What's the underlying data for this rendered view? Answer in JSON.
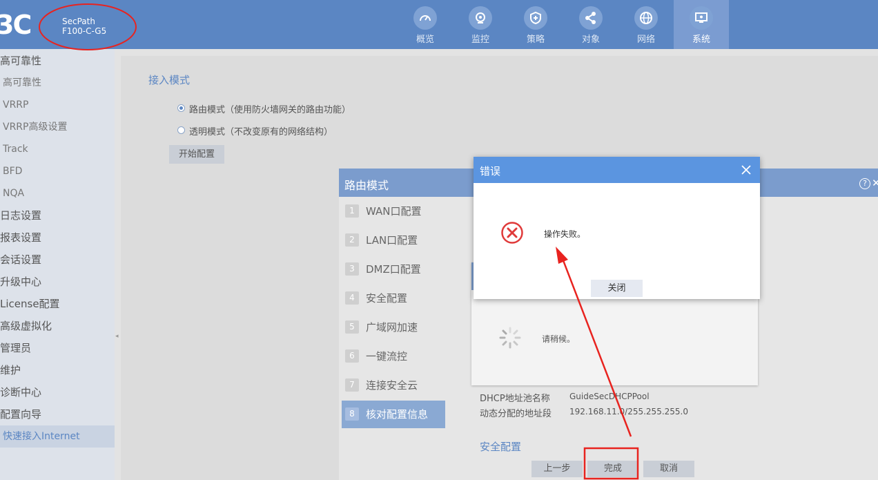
{
  "header": {
    "logo_text": "3C",
    "model_line1": "SecPath",
    "model_line2": "F100-C-G5",
    "nav": [
      {
        "label": "概览",
        "icon": "gauge-icon"
      },
      {
        "label": "监控",
        "icon": "camera-icon"
      },
      {
        "label": "策略",
        "icon": "shield-icon"
      },
      {
        "label": "对象",
        "icon": "share-icon"
      },
      {
        "label": "网络",
        "icon": "globe-icon"
      },
      {
        "label": "系统",
        "icon": "monitor-icon",
        "active": true
      }
    ]
  },
  "sidebar": {
    "items": [
      {
        "label": "高可靠性"
      },
      {
        "label": "高可靠性"
      },
      {
        "label": "VRRP"
      },
      {
        "label": "VRRP高级设置"
      },
      {
        "label": "Track"
      },
      {
        "label": "BFD"
      },
      {
        "label": "NQA"
      },
      {
        "label": "日志设置"
      },
      {
        "label": "报表设置"
      },
      {
        "label": "会话设置"
      },
      {
        "label": "升级中心"
      },
      {
        "label": "License配置"
      },
      {
        "label": "高级虚拟化"
      },
      {
        "label": "管理员"
      },
      {
        "label": "维护"
      },
      {
        "label": "诊断中心"
      },
      {
        "label": "配置向导"
      },
      {
        "label": "快速接入Internet",
        "active": true
      }
    ]
  },
  "main": {
    "section_title": "接入模式",
    "route_mode_label": "路由模式（使用防火墙网关的路由功能）",
    "transparent_mode_label": "透明模式（不改变原有的网络结构）",
    "selected_mode": "路由模式",
    "start_button": "开始配置"
  },
  "wizard": {
    "title": "路由模式",
    "help": "?",
    "steps": [
      {
        "num": "1",
        "label": "WAN口配置"
      },
      {
        "num": "2",
        "label": "LAN口配置"
      },
      {
        "num": "3",
        "label": "DMZ口配置"
      },
      {
        "num": "4",
        "label": "安全配置"
      },
      {
        "num": "5",
        "label": "广域网加速"
      },
      {
        "num": "6",
        "label": "一键流控"
      },
      {
        "num": "7",
        "label": "连接安全云"
      },
      {
        "num": "8",
        "label": "核对配置信息",
        "active": true
      }
    ],
    "waiting_text": "请稍候。",
    "dhcp_pool_label": "DHCP地址池名称",
    "dhcp_pool_value": "GuideSecDHCPPool",
    "dynamic_range_label": "动态分配的地址段",
    "dynamic_range_value": "192.168.11.0/255.255.255.0",
    "security_config": "安全配置",
    "prev_button": "上一步",
    "finish_button": "完成",
    "cancel_button": "取消"
  },
  "error_dialog": {
    "title": "错误",
    "message": "操作失败。",
    "close_button": "关闭"
  },
  "colors": {
    "header_bg": "#5b86c3",
    "dialog_header": "#5b95e0",
    "annotation_red": "#e8231f"
  }
}
